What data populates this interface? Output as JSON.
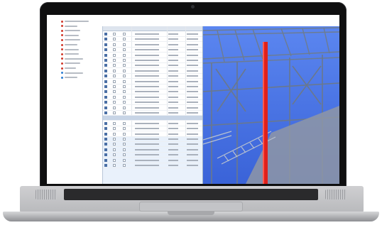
{
  "device": {
    "type": "laptop",
    "bezel_color": "#0f0f10",
    "body_color": "#c8c9cc"
  },
  "app": {
    "tree_items": [
      {
        "icon": "element-icon",
        "color": "#d03a2c"
      },
      {
        "icon": "element-icon",
        "color": "#d03a2c"
      },
      {
        "icon": "element-icon",
        "color": "#d03a2c"
      },
      {
        "icon": "element-icon",
        "color": "#d03a2c"
      },
      {
        "icon": "element-icon",
        "color": "#d03a2c"
      },
      {
        "icon": "element-icon",
        "color": "#d03a2c"
      },
      {
        "icon": "element-icon",
        "color": "#d03a2c"
      },
      {
        "icon": "element-icon",
        "color": "#d03a2c"
      },
      {
        "icon": "element-icon",
        "color": "#d03a2c"
      },
      {
        "icon": "element-icon",
        "color": "#d03a2c"
      },
      {
        "icon": "element-icon",
        "color": "#d03a2c"
      },
      {
        "icon": "group-icon",
        "color": "#2c7fd3"
      },
      {
        "icon": "group-icon",
        "color": "#2c7fd3"
      }
    ],
    "grid_row_count": 26,
    "selected_section_color": "#e9f1fb",
    "viewport": {
      "background": "#3f6fe8",
      "highlight_color": "#e0201b",
      "structure_color": "#6e7f94"
    }
  }
}
